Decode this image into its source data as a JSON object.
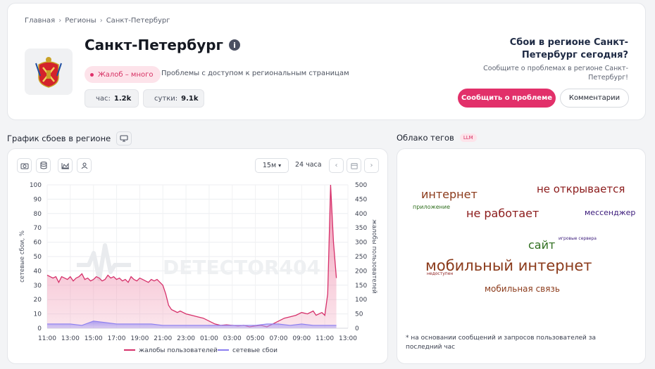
{
  "breadcrumb": [
    "Главная",
    "Регионы",
    "Санкт-Петербург"
  ],
  "header": {
    "title": "Санкт-Петербург",
    "badge": "Жалоб – много",
    "problems_text": "Проблемы с доступом к региональным страницам",
    "stat_hour_label": "час:",
    "stat_hour_value": "1.2k",
    "stat_day_label": "сутки:",
    "stat_day_value": "9.1k",
    "question": "Сбои в регионе Санкт-Петербург сегодня?",
    "question_sub": "Сообщите о проблемах в регионе Санкт-Петербург!",
    "report_button": "Сообщить о проблеме",
    "comments_button": "Комментарии"
  },
  "chart_section": {
    "title": "График сбоев в регионе",
    "interval": "15м",
    "range": "24 часа"
  },
  "cloud_section": {
    "title": "Облако тегов",
    "badge": "LLM",
    "note": "* на основании сообщений и запросов пользователей за последний час",
    "words": [
      {
        "text": "интернет",
        "color": "#8b3a1a"
      },
      {
        "text": "не открывается",
        "color": "#8b1a1a"
      },
      {
        "text": "приложение",
        "color": "#2f6e1e"
      },
      {
        "text": "не работает",
        "color": "#8b1a1a"
      },
      {
        "text": "мессенджер",
        "color": "#3a1a7a"
      },
      {
        "text": "игровые сервера",
        "color": "#3a1a7a"
      },
      {
        "text": "сайт",
        "color": "#2f6e1e"
      },
      {
        "text": "мобильный интернет",
        "color": "#8b3a1a"
      },
      {
        "text": "недоступен",
        "color": "#8b1a1a"
      },
      {
        "text": "мобильная связь",
        "color": "#8b3a1a"
      }
    ]
  },
  "chart_data": {
    "type": "area",
    "watermark": "DETECTOR404",
    "x_ticks": [
      "11:00",
      "13:00",
      "15:00",
      "17:00",
      "19:00",
      "21:00",
      "23:00",
      "01:00",
      "03:00",
      "05:00",
      "07:00",
      "09:00",
      "11:00",
      "13:00"
    ],
    "x_range_hours": [
      0,
      26
    ],
    "y_left": {
      "label": "сетевые сбои, %",
      "range": [
        0,
        100
      ],
      "ticks": [
        0,
        10,
        20,
        30,
        40,
        50,
        60,
        70,
        80,
        90,
        100
      ]
    },
    "y_right": {
      "label": "жалобы пользователей",
      "range": [
        0,
        500
      ],
      "ticks": [
        0,
        50,
        100,
        150,
        200,
        250,
        300,
        350,
        400,
        450,
        500
      ]
    },
    "series": [
      {
        "name": "жалобы пользователей",
        "color": "#d6306a",
        "axis": "right",
        "x": [
          0,
          0.25,
          0.5,
          0.75,
          1,
          1.25,
          1.5,
          1.75,
          2,
          2.25,
          2.5,
          2.75,
          3,
          3.25,
          3.5,
          3.75,
          4,
          4.25,
          4.5,
          4.75,
          5,
          5.25,
          5.5,
          5.75,
          6,
          6.25,
          6.5,
          6.75,
          7,
          7.25,
          7.5,
          7.75,
          8,
          8.25,
          8.5,
          8.75,
          9,
          9.25,
          9.5,
          9.75,
          10,
          10.25,
          10.5,
          10.75,
          11,
          11.25,
          11.5,
          11.75,
          12,
          12.5,
          13,
          13.5,
          14,
          14.5,
          15,
          15.5,
          16,
          16.5,
          17,
          17.5,
          18,
          18.5,
          19,
          19.5,
          20,
          20.5,
          21,
          21.5,
          22,
          22.5,
          23,
          23.25,
          23.5,
          23.75,
          24,
          24.25,
          24.5,
          24.75,
          25
        ],
        "values": [
          185,
          180,
          175,
          180,
          160,
          180,
          175,
          170,
          180,
          165,
          175,
          180,
          190,
          170,
          175,
          165,
          170,
          180,
          175,
          165,
          170,
          185,
          175,
          180,
          170,
          175,
          165,
          170,
          160,
          180,
          170,
          165,
          175,
          170,
          165,
          160,
          170,
          165,
          170,
          160,
          150,
          120,
          80,
          65,
          60,
          55,
          60,
          55,
          50,
          45,
          40,
          35,
          25,
          15,
          10,
          12,
          10,
          8,
          10,
          5,
          8,
          10,
          5,
          15,
          25,
          35,
          40,
          45,
          55,
          50,
          60,
          45,
          50,
          55,
          45,
          120,
          500,
          300,
          175
        ]
      },
      {
        "name": "сетевые сбои",
        "color": "#8b7ef0",
        "axis": "left",
        "x": [
          0,
          1,
          2,
          3,
          4,
          5,
          6,
          7,
          8,
          9,
          10,
          11,
          12,
          13,
          14,
          15,
          16,
          17,
          18,
          19,
          20,
          21,
          22,
          23,
          24,
          25
        ],
        "values": [
          3,
          3,
          3,
          2,
          5,
          4,
          3,
          3,
          3,
          3,
          2,
          2,
          2,
          2,
          2,
          2,
          2,
          2,
          2,
          3,
          3,
          2,
          3,
          2,
          2,
          2
        ]
      }
    ],
    "legend_position": "bottom"
  }
}
